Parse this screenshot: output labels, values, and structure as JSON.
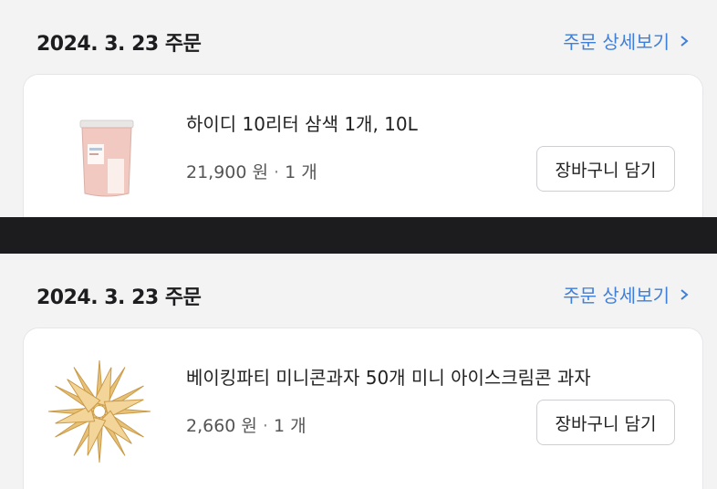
{
  "orders": [
    {
      "date_label": "2024. 3. 23 주문",
      "detail_link": "주문 상세보기",
      "item": {
        "name": "하이디 10리터 삼색 1개, 10L",
        "price": "21,900 원",
        "separator": "·",
        "quantity": "1 개",
        "icon": "ice-cream-tub"
      },
      "cart_button": "장바구니 담기"
    },
    {
      "date_label": "2024. 3. 23 주문",
      "detail_link": "주문 상세보기",
      "item": {
        "name": "베이킹파티 미니콘과자 50개 미니 아이스크림콘 과자",
        "price": "2,660 원",
        "separator": "·",
        "quantity": "1 개",
        "icon": "mini-cones"
      },
      "cart_button": "장바구니 담기"
    }
  ],
  "colors": {
    "link": "#3e7fd9",
    "divider": "#1c1c1e",
    "background": "#f3f3f4"
  }
}
